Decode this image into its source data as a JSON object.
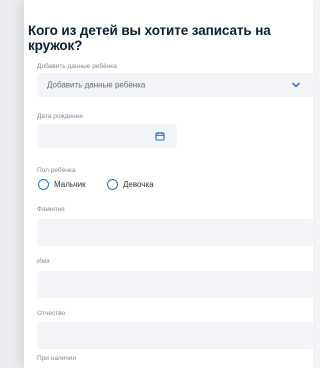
{
  "form": {
    "title": "Кого из детей вы хотите записать на кружок?",
    "child_select": {
      "label": "Добавить данные ребёнка",
      "value": "Добавить данные ребёнка",
      "icon": "chevron-down-icon"
    },
    "birth_date": {
      "label": "Дата рождения",
      "value": "",
      "icon": "calendar-icon"
    },
    "gender": {
      "label": "Пол ребёнка",
      "options": [
        "Мальчик",
        "Девочка"
      ]
    },
    "last_name": {
      "label": "Фамилия",
      "value": ""
    },
    "first_name": {
      "label": "Имя",
      "value": ""
    },
    "middle_name": {
      "label": "Отчество",
      "value": ""
    },
    "extra_label": "При наличии"
  },
  "colors": {
    "accent": "#2b6bd4",
    "field_bg": "#f2f4f7",
    "title": "#0b1f33"
  }
}
